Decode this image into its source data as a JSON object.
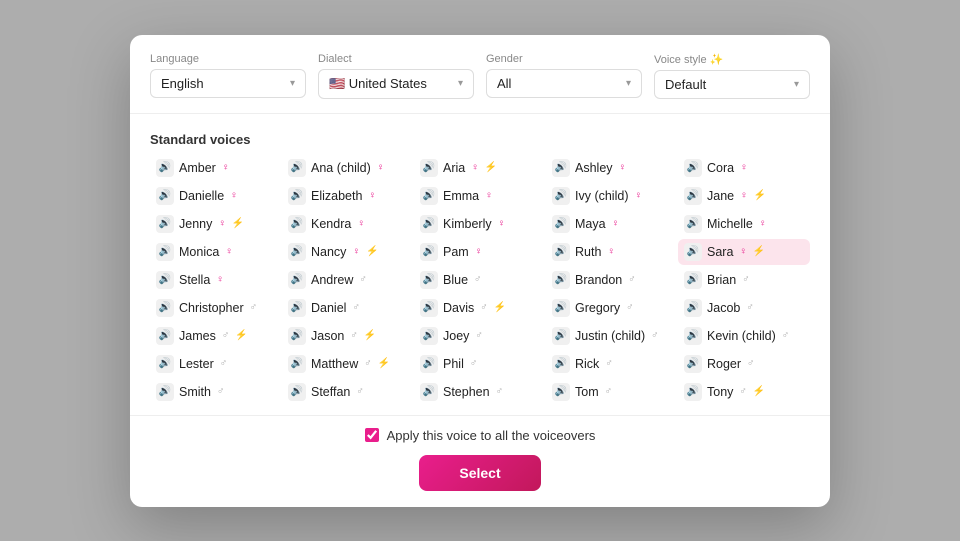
{
  "filters": {
    "language_label": "Language",
    "dialect_label": "Dialect",
    "gender_label": "Gender",
    "voice_style_label": "Voice style ✨",
    "language_value": "English",
    "dialect_value": "🇺🇸 United States",
    "gender_value": "All",
    "voice_style_value": "Default"
  },
  "standard_section_title": "Standard voices",
  "voices_row1": [
    {
      "name": "Amber",
      "tags": [
        "♀"
      ]
    },
    {
      "name": "Ana (child)",
      "tags": [
        "♀"
      ]
    },
    {
      "name": "Aria",
      "tags": [
        "♀",
        "⚡"
      ]
    },
    {
      "name": "Ashley",
      "tags": [
        "♀"
      ]
    },
    {
      "name": "Cora",
      "tags": [
        "♀"
      ]
    }
  ],
  "voices_row2": [
    {
      "name": "Danielle",
      "tags": [
        "♀"
      ]
    },
    {
      "name": "Elizabeth",
      "tags": [
        "♀"
      ]
    },
    {
      "name": "Emma",
      "tags": [
        "♀"
      ]
    },
    {
      "name": "Ivy (child)",
      "tags": [
        "♀"
      ]
    },
    {
      "name": "Jane",
      "tags": [
        "♀",
        "⚡"
      ]
    }
  ],
  "voices_row3": [
    {
      "name": "Jenny",
      "tags": [
        "♀",
        "⚡"
      ]
    },
    {
      "name": "Kendra",
      "tags": [
        "♀"
      ]
    },
    {
      "name": "Kimberly",
      "tags": [
        "♀"
      ]
    },
    {
      "name": "Maya",
      "tags": [
        "♀"
      ]
    },
    {
      "name": "Michelle",
      "tags": [
        "♀"
      ]
    }
  ],
  "voices_row4": [
    {
      "name": "Monica",
      "tags": [
        "♀"
      ]
    },
    {
      "name": "Nancy",
      "tags": [
        "♀",
        "⚡"
      ]
    },
    {
      "name": "Pam",
      "tags": [
        "♀"
      ]
    },
    {
      "name": "Ruth",
      "tags": [
        "♀"
      ]
    },
    {
      "name": "Sara",
      "tags": [
        "♀",
        "⚡"
      ],
      "selected": true
    }
  ],
  "voices_row5": [
    {
      "name": "Stella",
      "tags": [
        "♀"
      ]
    },
    {
      "name": "Andrew",
      "tags": [
        "♂"
      ]
    },
    {
      "name": "Blue",
      "tags": [
        "♂"
      ]
    },
    {
      "name": "Brandon",
      "tags": [
        "♂"
      ]
    },
    {
      "name": "Brian",
      "tags": [
        "♂"
      ]
    }
  ],
  "voices_row6": [
    {
      "name": "Christopher",
      "tags": [
        "♂"
      ]
    },
    {
      "name": "Daniel",
      "tags": [
        "♂"
      ]
    },
    {
      "name": "Davis",
      "tags": [
        "♂",
        "⚡"
      ]
    },
    {
      "name": "Gregory",
      "tags": [
        "♂"
      ]
    },
    {
      "name": "Jacob",
      "tags": [
        "♂"
      ]
    }
  ],
  "voices_row7": [
    {
      "name": "James",
      "tags": [
        "♂",
        "⚡"
      ]
    },
    {
      "name": "Jason",
      "tags": [
        "♂",
        "⚡"
      ]
    },
    {
      "name": "Joey",
      "tags": [
        "♂"
      ]
    },
    {
      "name": "Justin (child)",
      "tags": [
        "♂"
      ]
    },
    {
      "name": "Kevin (child)",
      "tags": [
        "♂"
      ]
    }
  ],
  "voices_row8": [
    {
      "name": "Lester",
      "tags": [
        "♂"
      ]
    },
    {
      "name": "Matthew",
      "tags": [
        "♂",
        "⚡"
      ]
    },
    {
      "name": "Phil",
      "tags": [
        "♂"
      ]
    },
    {
      "name": "Rick",
      "tags": [
        "♂"
      ]
    },
    {
      "name": "Roger",
      "tags": [
        "♂"
      ]
    }
  ],
  "voices_row9": [
    {
      "name": "Smith",
      "tags": [
        "♂"
      ]
    },
    {
      "name": "Steffan",
      "tags": [
        "♂"
      ]
    },
    {
      "name": "Stephen",
      "tags": [
        "♂"
      ]
    },
    {
      "name": "Tom",
      "tags": [
        "♂"
      ]
    },
    {
      "name": "Tony",
      "tags": [
        "♂",
        "⚡"
      ]
    }
  ],
  "footer": {
    "apply_checkbox_label": "Apply this voice to all the voiceovers",
    "select_button_label": "Select"
  }
}
